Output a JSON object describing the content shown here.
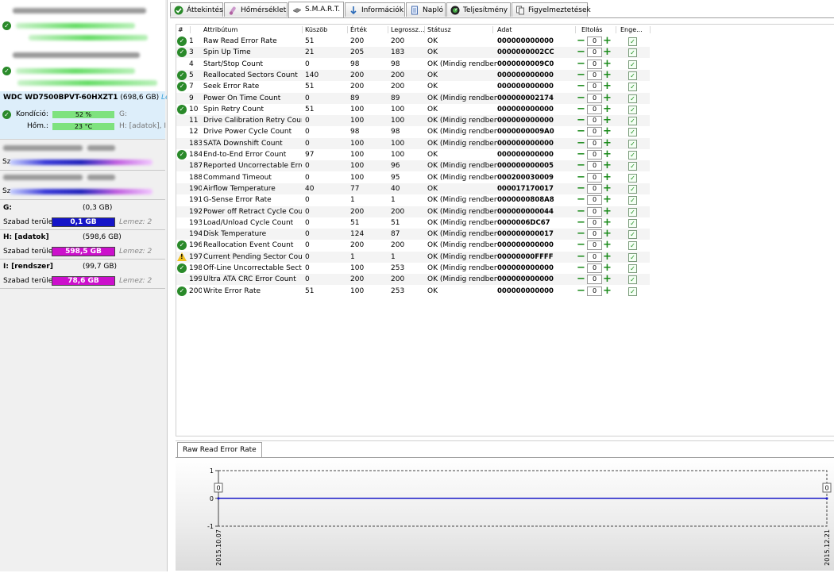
{
  "sidebar": {
    "selected_disk": {
      "model": "WDC WD7500BPVT-60HXZT1",
      "capacity": "(698,6 GB)",
      "lez": "Le",
      "kondicio_label": "Kondíció:",
      "kondicio_value": "52 %",
      "kondicio_drive": "G:",
      "hom_label": "Hőm.:",
      "hom_value": "23 °C",
      "hom_drive": "H: [adatok], I:"
    },
    "partitions": [
      {
        "name": "G:",
        "capacity": "(0,3 GB)",
        "free_label": "Szabad terület",
        "free_value": "0,1 GB",
        "lez": "Lemez: 2",
        "color": "#1414c8"
      },
      {
        "name": "H: [adatok]",
        "capacity": "(598,6 GB)",
        "free_label": "Szabad terület",
        "free_value": "598,5 GB",
        "lez": "Lemez: 2",
        "color": "#cc10cc"
      },
      {
        "name": "I: [rendszer]",
        "capacity": "(99,7 GB)",
        "free_label": "Szabad terület",
        "free_value": "78,6 GB",
        "lez": "Lemez: 2",
        "color": "#cc10cc"
      }
    ],
    "partial_labels": [
      "Sz",
      "Sz"
    ]
  },
  "tabs": [
    "Áttekintés",
    "Hőmérséklet",
    "S.M.A.R.T.",
    "Információk",
    "Napló",
    "Teljesítmény",
    "Figyelmeztetések"
  ],
  "smart": {
    "headers": [
      "#",
      "Attribútum",
      "Küszöb",
      "Érték",
      "Legrossz...",
      "Státusz",
      "Adat",
      "Eltolás",
      "Enge..."
    ],
    "rows": [
      {
        "id": "1",
        "name": "Raw Read Error Rate",
        "thr": "51",
        "val": "200",
        "worst": "200",
        "status": "OK",
        "data": "000000000000",
        "icon": "ok"
      },
      {
        "id": "3",
        "name": "Spin Up Time",
        "thr": "21",
        "val": "205",
        "worst": "183",
        "status": "OK",
        "data": "0000000002CC",
        "icon": "ok"
      },
      {
        "id": "4",
        "name": "Start/Stop Count",
        "thr": "0",
        "val": "98",
        "worst": "98",
        "status": "OK (Mindig rendben)",
        "data": "0000000009C0",
        "icon": ""
      },
      {
        "id": "5",
        "name": "Reallocated Sectors Count",
        "thr": "140",
        "val": "200",
        "worst": "200",
        "status": "OK",
        "data": "000000000000",
        "icon": "ok"
      },
      {
        "id": "7",
        "name": "Seek Error Rate",
        "thr": "51",
        "val": "200",
        "worst": "200",
        "status": "OK",
        "data": "000000000000",
        "icon": "ok"
      },
      {
        "id": "9",
        "name": "Power On Time Count",
        "thr": "0",
        "val": "89",
        "worst": "89",
        "status": "OK (Mindig rendben)",
        "data": "000000002174",
        "icon": ""
      },
      {
        "id": "10",
        "name": "Spin Retry Count",
        "thr": "51",
        "val": "100",
        "worst": "100",
        "status": "OK",
        "data": "000000000000",
        "icon": "ok"
      },
      {
        "id": "11",
        "name": "Drive Calibration Retry Count",
        "thr": "0",
        "val": "100",
        "worst": "100",
        "status": "OK (Mindig rendben)",
        "data": "000000000000",
        "icon": ""
      },
      {
        "id": "12",
        "name": "Drive Power Cycle Count",
        "thr": "0",
        "val": "98",
        "worst": "98",
        "status": "OK (Mindig rendben)",
        "data": "0000000009A0",
        "icon": ""
      },
      {
        "id": "183",
        "name": "SATA Downshift Count",
        "thr": "0",
        "val": "100",
        "worst": "100",
        "status": "OK (Mindig rendben)",
        "data": "000000000000",
        "icon": ""
      },
      {
        "id": "184",
        "name": "End-to-End Error Count",
        "thr": "97",
        "val": "100",
        "worst": "100",
        "status": "OK",
        "data": "000000000000",
        "icon": "ok"
      },
      {
        "id": "187",
        "name": "Reported Uncorrectable Errors",
        "thr": "0",
        "val": "100",
        "worst": "96",
        "status": "OK (Mindig rendben)",
        "data": "000000000005",
        "icon": ""
      },
      {
        "id": "188",
        "name": "Command Timeout",
        "thr": "0",
        "val": "100",
        "worst": "95",
        "status": "OK (Mindig rendben)",
        "data": "000200030009",
        "icon": ""
      },
      {
        "id": "190",
        "name": "Airflow Temperature",
        "thr": "40",
        "val": "77",
        "worst": "40",
        "status": "OK",
        "data": "000017170017",
        "icon": ""
      },
      {
        "id": "191",
        "name": "G-Sense Error Rate",
        "thr": "0",
        "val": "1",
        "worst": "1",
        "status": "OK (Mindig rendben)",
        "data": "0000000808A8",
        "icon": ""
      },
      {
        "id": "192",
        "name": "Power off Retract Cycle Count",
        "thr": "0",
        "val": "200",
        "worst": "200",
        "status": "OK (Mindig rendben)",
        "data": "000000000044",
        "icon": ""
      },
      {
        "id": "193",
        "name": "Load/Unload Cycle Count",
        "thr": "0",
        "val": "51",
        "worst": "51",
        "status": "OK (Mindig rendben)",
        "data": "0000006DC67",
        "icon": ""
      },
      {
        "id": "194",
        "name": "Disk Temperature",
        "thr": "0",
        "val": "124",
        "worst": "87",
        "status": "OK (Mindig rendben)",
        "data": "000000000017",
        "icon": ""
      },
      {
        "id": "196",
        "name": "Reallocation Event Count",
        "thr": "0",
        "val": "200",
        "worst": "200",
        "status": "OK (Mindig rendben)",
        "data": "000000000000",
        "icon": "ok"
      },
      {
        "id": "197",
        "name": "Current Pending Sector Count",
        "thr": "0",
        "val": "1",
        "worst": "1",
        "status": "OK (Mindig rendben)",
        "data": "00000000FFFF",
        "icon": "warn"
      },
      {
        "id": "198",
        "name": "Off-Line Uncorrectable Sector...",
        "thr": "0",
        "val": "100",
        "worst": "253",
        "status": "OK (Mindig rendben)",
        "data": "000000000000",
        "icon": "ok"
      },
      {
        "id": "199",
        "name": "Ultra ATA CRC Error Count",
        "thr": "0",
        "val": "200",
        "worst": "200",
        "status": "OK (Mindig rendben)",
        "data": "000000000000",
        "icon": ""
      },
      {
        "id": "200",
        "name": "Write Error Rate",
        "thr": "51",
        "val": "100",
        "worst": "253",
        "status": "OK",
        "data": "000000000000",
        "icon": "ok"
      }
    ],
    "offset_value": "0",
    "minus_glyph": "−",
    "plus_glyph": "+",
    "check_glyph": "✓"
  },
  "chart_panel": {
    "tab_label": "Raw Read Error Rate"
  },
  "chart_data": {
    "type": "line",
    "title": "Raw Read Error Rate",
    "x": [
      "2015.10.07",
      "2015.12.21"
    ],
    "series": [
      {
        "values": [
          0,
          0
        ]
      }
    ],
    "ylim": [
      -1,
      1
    ],
    "yticks": [
      "1",
      "0",
      "-1"
    ],
    "point_labels": [
      "0",
      "0"
    ],
    "line_color": "#1a1ac8",
    "grid": false
  }
}
